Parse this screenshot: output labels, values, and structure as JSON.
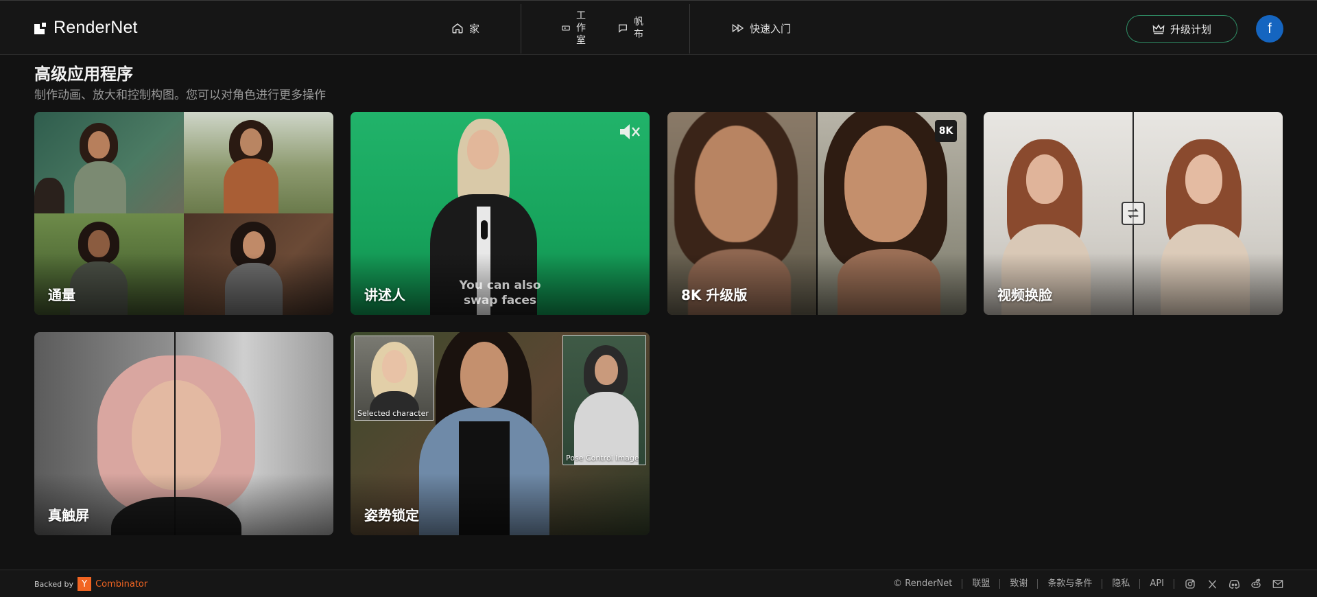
{
  "header": {
    "logo": "RenderNet",
    "nav": {
      "home": "家",
      "studio": [
        "工",
        "作",
        "室"
      ],
      "canvas": [
        "帆",
        "布"
      ],
      "quick_start": "快速入门"
    },
    "upgrade_label": "升级计划",
    "avatar_letter": "f"
  },
  "section": {
    "title": "高级应用程序",
    "subtitle": "制作动画、放大和控制构图。您可以对角色进行更多操作"
  },
  "cards": [
    {
      "label": "通量"
    },
    {
      "label": "讲述人",
      "overlay": "You can also swap faces"
    },
    {
      "label": "8K 升级版",
      "badge": "8K"
    },
    {
      "label": "视频换脸"
    },
    {
      "label": "真触屏"
    },
    {
      "label": "姿势锁定",
      "thumb_left": "Selected character",
      "thumb_right": "Pose Control Image"
    }
  ],
  "footer": {
    "backed_by": "Backed by",
    "yc_letter": "Y",
    "yc_name": "Combinator",
    "copyright": "© RenderNet",
    "links": [
      "联盟",
      "致谢",
      "条款与条件",
      "隐私",
      "API"
    ],
    "icons": [
      "instagram-icon",
      "x-icon",
      "discord-icon",
      "reddit-icon",
      "mail-icon"
    ]
  },
  "colors": {
    "background": "#121212",
    "accent_border": "#2f8f66",
    "avatar": "#1565c0",
    "yc": "#f26522"
  }
}
